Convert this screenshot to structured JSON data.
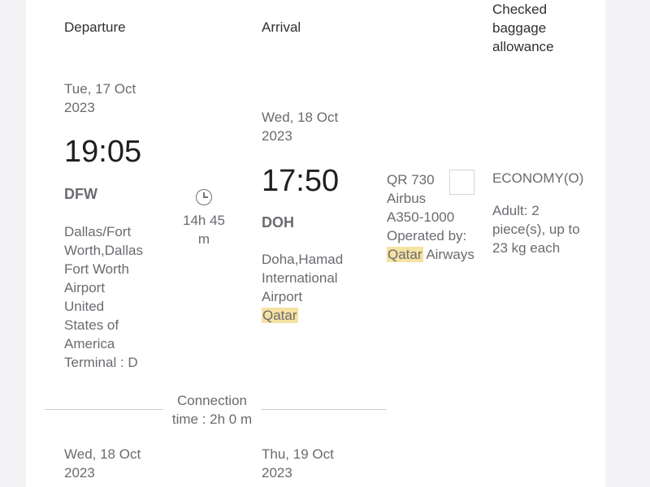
{
  "headers": {
    "departure": "Departure",
    "arrival": "Arrival",
    "baggage": [
      "Checked",
      "baggage",
      "allowance"
    ]
  },
  "segment1": {
    "departure": {
      "date_line1": "Tue, 17 Oct",
      "date_line2": "2023",
      "time": "19:05",
      "code": "DFW",
      "place_lines": [
        "Dallas/Fort",
        "Worth,Dallas",
        "Fort Worth",
        "Airport",
        "United",
        "States of",
        "America"
      ],
      "terminal": "Terminal : D"
    },
    "duration_line1": "14h 45",
    "duration_line2": "m",
    "arrival": {
      "date_line1": "Wed, 18 Oct",
      "date_line2": "2023",
      "time": "17:50",
      "code": "DOH",
      "place_lines": [
        "Doha,Hamad",
        "International",
        "Airport"
      ],
      "country": "Qatar"
    },
    "flight": {
      "number": "QR 730",
      "aircraft_line1": "Airbus",
      "aircraft_line2": "A350-1000",
      "operated_by": "Operated by:",
      "operator_highlight": "Qatar",
      "operator_rest": " Airways"
    },
    "baggage": {
      "cabin": "ECONOMY(O)",
      "allowance_lines": [
        "Adult: 2",
        "piece(s), up to",
        "23 kg each"
      ]
    }
  },
  "connection": {
    "line1": "Connection",
    "line2": "time : 2h 0 m"
  },
  "segment2": {
    "departure_date_line1": "Wed, 18 Oct",
    "departure_date_line2": "2023",
    "arrival_date_line1": "Thu, 19 Oct",
    "arrival_date_line2": "2023"
  }
}
